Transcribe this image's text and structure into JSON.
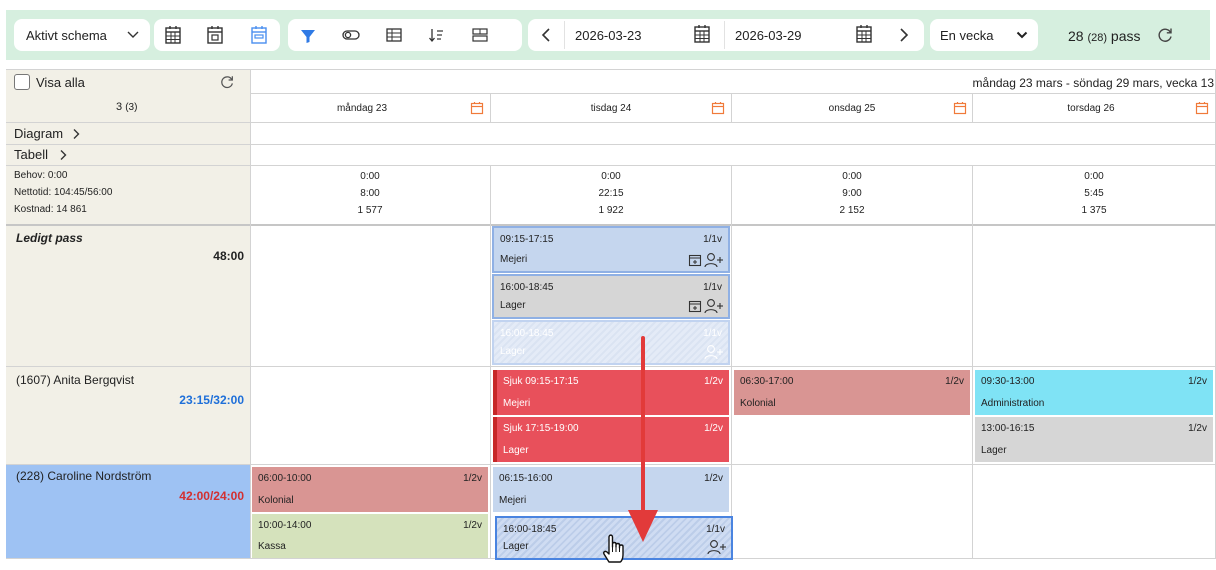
{
  "toolbar": {
    "schedule_select": "Aktivt schema",
    "date_from": "2026-03-23",
    "date_to": "2026-03-29",
    "period_select": "En vecka",
    "count_main": "28",
    "count_sub": "(28)",
    "count_unit": "pass"
  },
  "left": {
    "show_all_label": "Visa alla",
    "selected_count": "3",
    "selected_count_sub": "(3)",
    "diagram_label": "Diagram",
    "table_label": "Tabell",
    "summary": {
      "need": "Behov: 0:00",
      "net": "Nettotid: 104:45/56:00",
      "cost": "Kostnad: 14 861"
    }
  },
  "header": {
    "range_title": "måndag 23 mars - söndag 29 mars, vecka 13",
    "days": [
      {
        "label": "måndag 23",
        "need": "0:00",
        "net": "8:00",
        "cost": "1 577"
      },
      {
        "label": "tisdag 24",
        "need": "0:00",
        "net": "22:15",
        "cost": "1 922"
      },
      {
        "label": "onsdag 25",
        "need": "0:00",
        "net": "9:00",
        "cost": "2 152"
      },
      {
        "label": "torsdag 26",
        "need": "0:00",
        "net": "5:45",
        "cost": "1 375"
      }
    ]
  },
  "rows": [
    {
      "name": "Ledigt pass",
      "hours": "48:00"
    },
    {
      "name": "(1607) Anita Bergqvist",
      "hours": "23:15/32:00"
    },
    {
      "name": "(228) Caroline Nordström",
      "hours": "42:00/24:00"
    }
  ],
  "shifts": {
    "open_tue_1": {
      "time": "09:15-17:15",
      "ratio": "1/1v",
      "dept": "Mejeri"
    },
    "open_tue_2": {
      "time": "16:00-18:45",
      "ratio": "1/1v",
      "dept": "Lager"
    },
    "open_tue_ghost": {
      "time": "16:00-18:45",
      "ratio": "1/1v",
      "dept": "Lager"
    },
    "anita_tue_1": {
      "time": "Sjuk 09:15-17:15",
      "ratio": "1/2v",
      "dept": "Mejeri"
    },
    "anita_tue_2": {
      "time": "Sjuk 17:15-19:00",
      "ratio": "1/2v",
      "dept": "Lager"
    },
    "anita_wed_1": {
      "time": "06:30-17:00",
      "ratio": "1/2v",
      "dept": "Kolonial"
    },
    "anita_thu_1": {
      "time": "09:30-13:00",
      "ratio": "1/2v",
      "dept": "Administration"
    },
    "anita_thu_2": {
      "time": "13:00-16:15",
      "ratio": "1/2v",
      "dept": "Lager"
    },
    "caro_mon_1": {
      "time": "06:00-10:00",
      "ratio": "1/2v",
      "dept": "Kolonial"
    },
    "caro_mon_2": {
      "time": "10:00-14:00",
      "ratio": "1/2v",
      "dept": "Kassa"
    },
    "caro_tue_1": {
      "time": "06:15-16:00",
      "ratio": "1/2v",
      "dept": "Mejeri"
    },
    "caro_tue_drag": {
      "time": "16:00-18:45",
      "ratio": "1/1v",
      "dept": "Lager"
    }
  },
  "colors": {
    "toolbar_bg": "#d6efdf",
    "open_shift": "#c5d6ee",
    "lager_gray": "#d6d6d6",
    "sick_red": "#e8505b",
    "kolonial_rose": "#d99593",
    "admin_cyan": "#7fe3f5",
    "kassa_green": "#d5e2bc",
    "selected_row": "#9ec2f3",
    "drag_arrow": "#e23a3a",
    "accent_orange": "#f07a3a",
    "accent_blue": "#1e6fd9"
  }
}
